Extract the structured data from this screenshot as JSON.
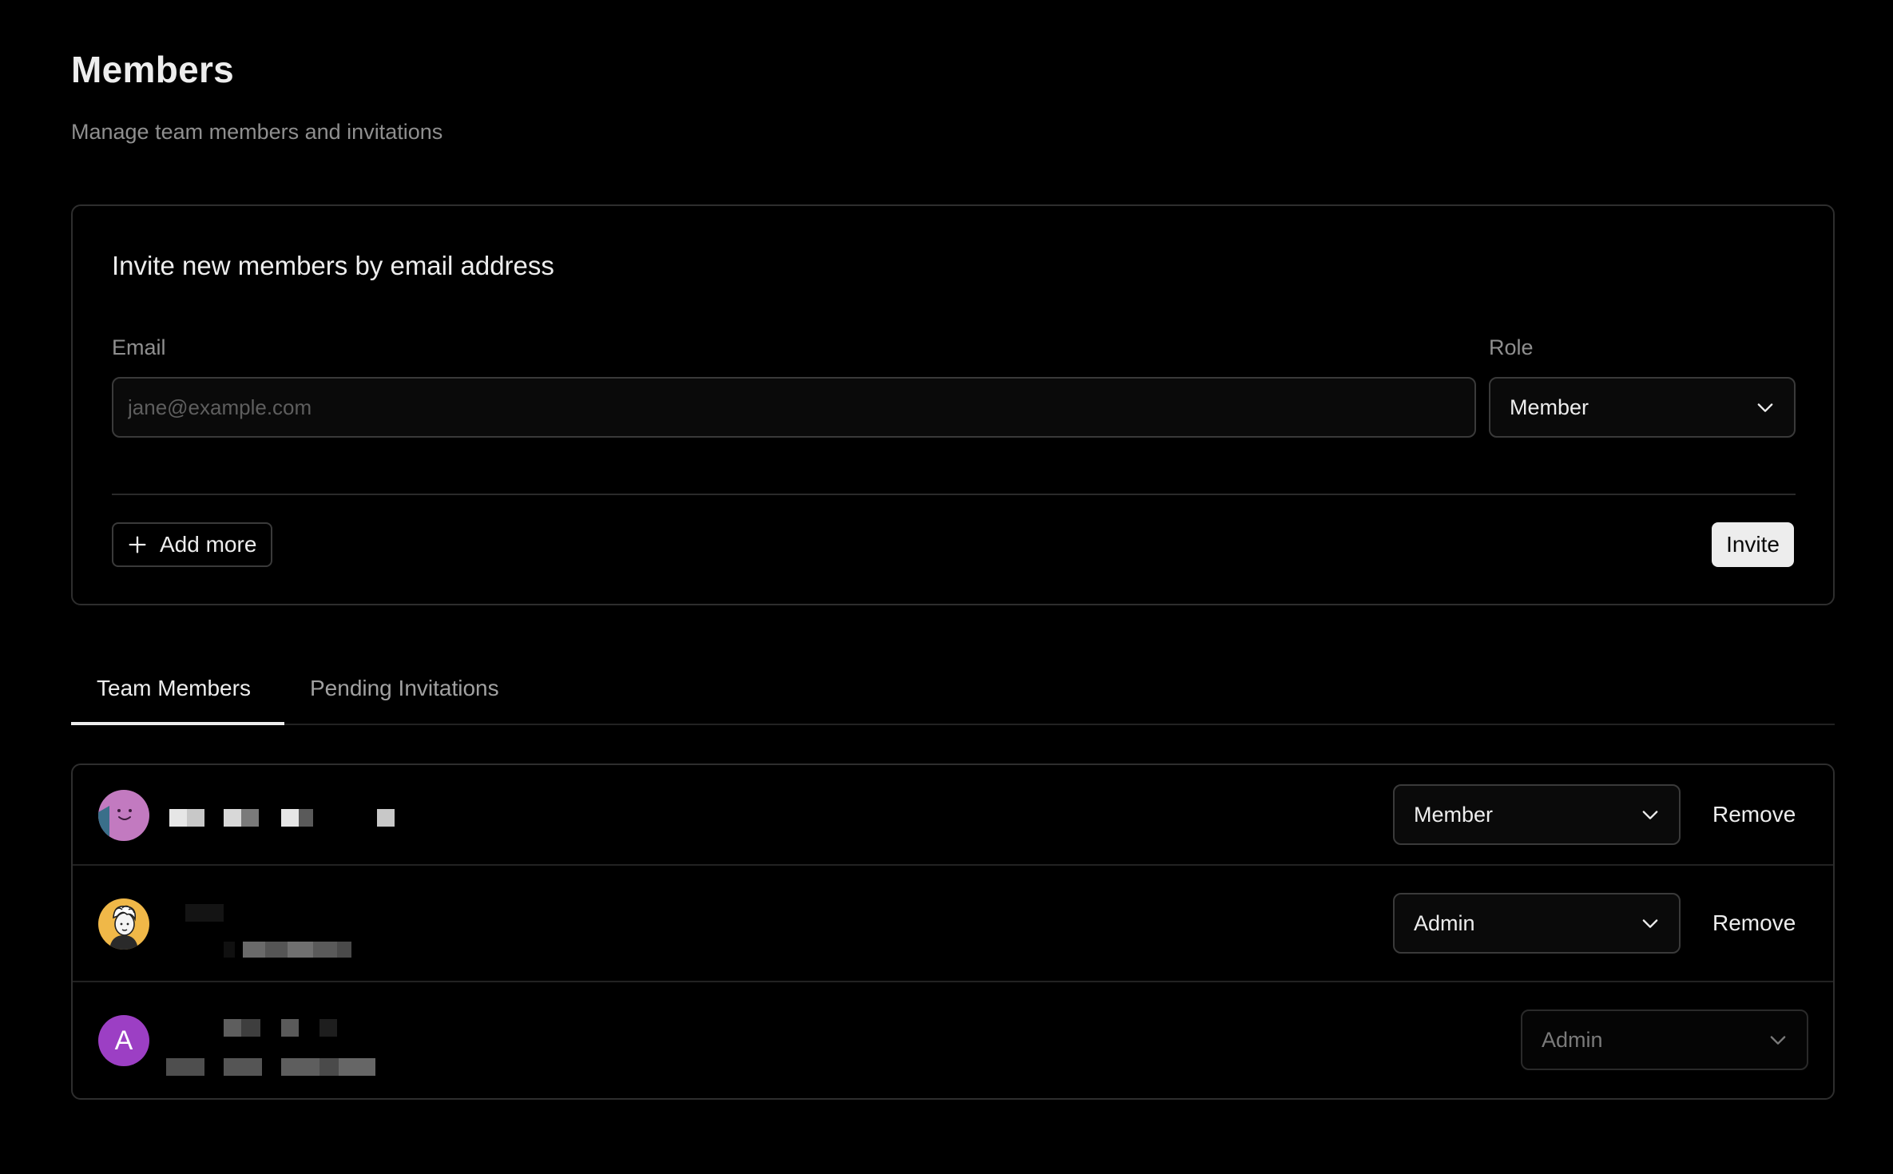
{
  "page": {
    "title": "Members",
    "subtitle": "Manage team members and invitations"
  },
  "invite": {
    "heading": "Invite new members by email address",
    "email_label": "Email",
    "email_placeholder": "jane@example.com",
    "email_value": "",
    "role_label": "Role",
    "role_value": "Member",
    "add_more_label": "Add more",
    "invite_button": "Invite"
  },
  "tabs": [
    {
      "label": "Team Members",
      "active": true
    },
    {
      "label": "Pending Invitations",
      "active": false
    }
  ],
  "members": [
    {
      "avatar": "smiley-avatar",
      "role": "Member",
      "remove_label": "Remove",
      "role_disabled": false
    },
    {
      "avatar": "illustrated-person-avatar",
      "role": "Admin",
      "remove_label": "Remove",
      "role_disabled": false
    },
    {
      "avatar_letter": "A",
      "role": "Admin",
      "role_disabled": true
    }
  ],
  "colors": {
    "background": "#000000",
    "text": "#ededed",
    "muted": "#8f8f8f",
    "border": "#2e2e2e",
    "invite_button_bg": "#ededed",
    "avatar_letter_bg": "#9c3fc4",
    "avatar_smiley_bg": "#c27ac0"
  }
}
